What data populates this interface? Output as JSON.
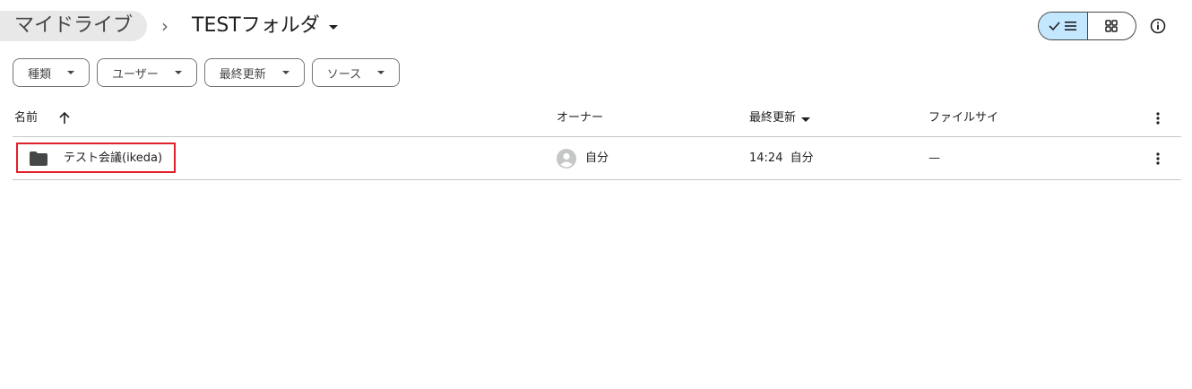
{
  "breadcrumb": {
    "root": "マイドライブ",
    "separator": "›",
    "current": "TESTフォルダ"
  },
  "view_toggle": {
    "list_icon": "check-list-icon",
    "grid_icon": "grid-icon"
  },
  "info_icon": "info-icon",
  "filters": [
    {
      "label": "種類"
    },
    {
      "label": "ユーザー"
    },
    {
      "label": "最終更新"
    },
    {
      "label": "ソース"
    }
  ],
  "table": {
    "columns": {
      "name": "名前",
      "owner": "オーナー",
      "modified": "最終更新",
      "size": "ファイルサイ"
    },
    "rows": [
      {
        "name": "テスト会議(ikeda)",
        "icon": "folder-icon",
        "owner": "自分",
        "modified_time": "14:24",
        "modified_by": "自分",
        "size": "—"
      }
    ]
  },
  "colors": {
    "accent": "#c2e7ff",
    "highlight": "#e0202a",
    "border": "#c7c7c7"
  }
}
